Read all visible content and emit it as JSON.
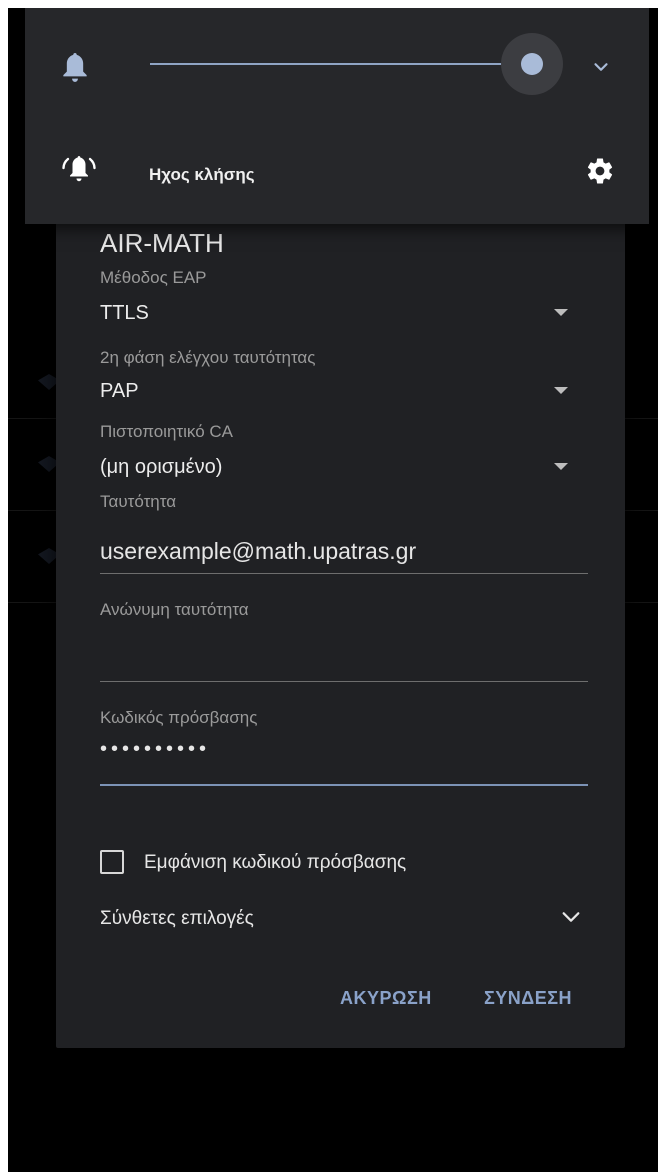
{
  "volume_panel": {
    "ringtone_label": "Ηχος κλήσης",
    "volume_level_percent": 100
  },
  "dialog": {
    "network_name": "AIR-MATH",
    "eap_method": {
      "label": "Μέθοδος EAP",
      "value": "TTLS"
    },
    "phase2_auth": {
      "label": "2η φάση ελέγχου ταυτότητας",
      "value": "PAP"
    },
    "ca_certificate": {
      "label": "Πιστοποιητικό CA",
      "value": "(μη ορισμένο)"
    },
    "identity": {
      "label": "Ταυτότητα",
      "value": "userexample@math.upatras.gr"
    },
    "anonymous_identity": {
      "label": "Ανώνυμη ταυτότητα",
      "value": ""
    },
    "password": {
      "label": "Κωδικός πρόσβασης",
      "masked_value": "••••••••••"
    },
    "show_password": {
      "label": "Εμφάνιση κωδικού πρόσβασης",
      "checked": false
    },
    "advanced_options": {
      "label": "Σύνθετες επιλογές"
    },
    "buttons": {
      "cancel": "ΑΚΥΡΩΣΗ",
      "connect": "ΣΥΝΔΕΣΗ"
    }
  },
  "colors": {
    "accent": "#8aa2c9",
    "slider": "#a9bbd8",
    "dialog_background": "#202124",
    "panel_background": "#26272a"
  }
}
